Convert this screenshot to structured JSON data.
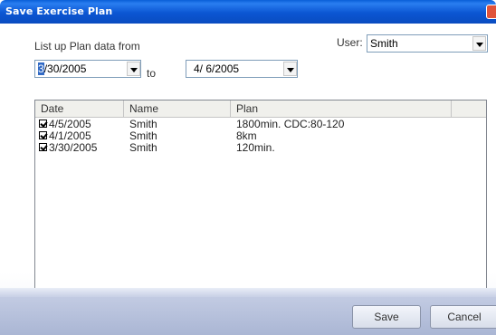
{
  "window": {
    "title": "Save Exercise Plan"
  },
  "filter": {
    "list_label": "List up Plan data from",
    "to_label": "to",
    "from_date": {
      "selected_char": "3",
      "rest": "/30/2005"
    },
    "to_date": "4/ 6/2005",
    "user_label": "User:",
    "user_value": "Smith"
  },
  "table": {
    "columns": [
      "Date",
      "Name",
      "Plan"
    ],
    "rows": [
      {
        "checked": true,
        "date": "4/5/2005",
        "name": "Smith",
        "plan": "1800min. CDC:80-120"
      },
      {
        "checked": true,
        "date": "4/1/2005",
        "name": "Smith",
        "plan": "8km"
      },
      {
        "checked": true,
        "date": "3/30/2005",
        "name": "Smith",
        "plan": "120min."
      }
    ]
  },
  "buttons": {
    "save": "Save",
    "cancel": "Cancel"
  },
  "icons": {
    "close": "close-icon",
    "dropdown": "chevron-down-icon",
    "checkbox": "checkbox-checked-icon"
  }
}
